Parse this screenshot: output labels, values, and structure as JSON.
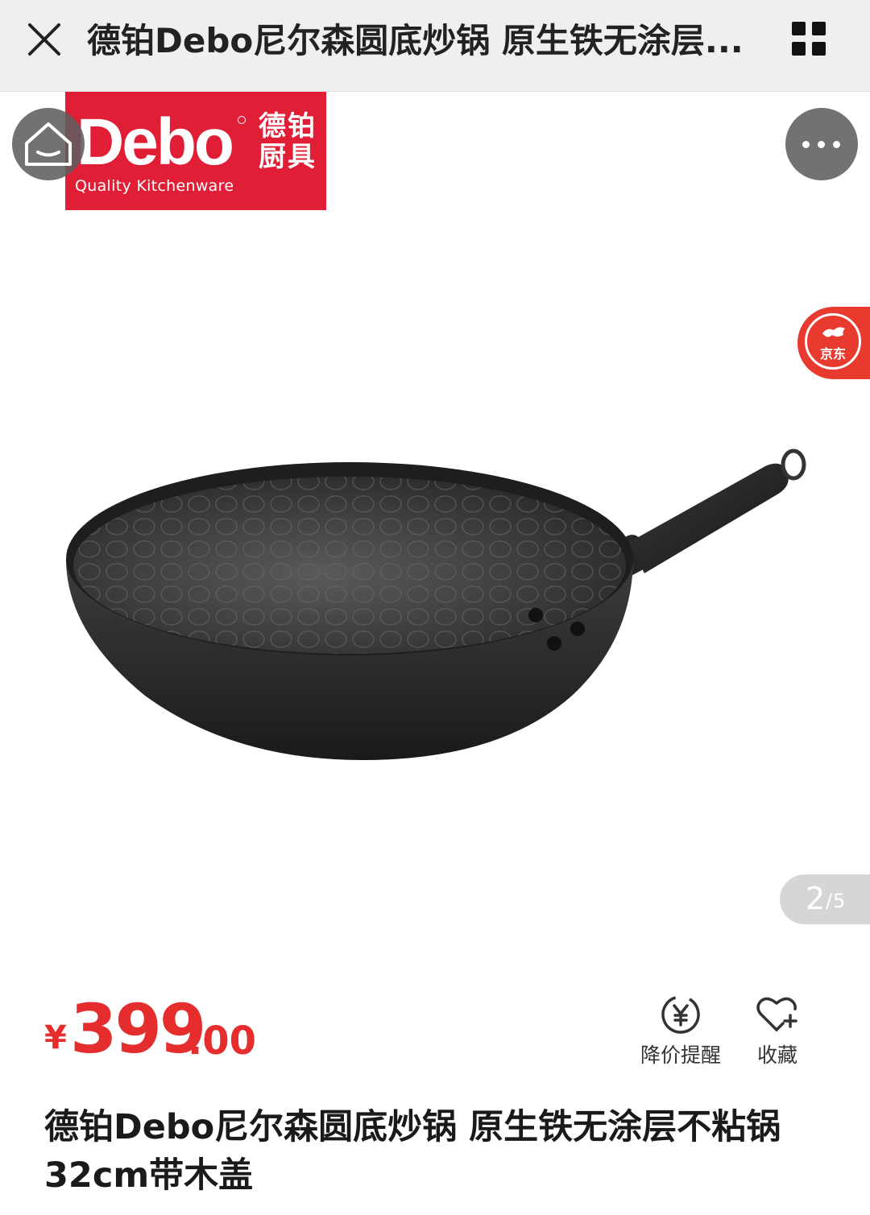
{
  "header": {
    "title": "德铂Debo尼尔森圆底炒锅 原生铁无涂层...",
    "close_icon": "close-icon",
    "menu_icon": "grid-menu-icon"
  },
  "gallery": {
    "logo": {
      "brand": "Debo",
      "brand_cn": "德铂厨具",
      "tagline": "Quality Kitchenware",
      "color": "#e01e36"
    },
    "jd_badge": {
      "label": "京东",
      "color": "#e83a2e"
    },
    "counter": {
      "current": "2",
      "separator": "/",
      "total": "5"
    }
  },
  "price": {
    "symbol": "¥",
    "integer": "399",
    "decimal": ".00",
    "color": "#e52d2d"
  },
  "actions": {
    "price_alert": "降价提醒",
    "favorite": "收藏"
  },
  "product": {
    "name": "德铂Debo尼尔森圆底炒锅 原生铁无涂层不粘锅32cm带木盖"
  }
}
